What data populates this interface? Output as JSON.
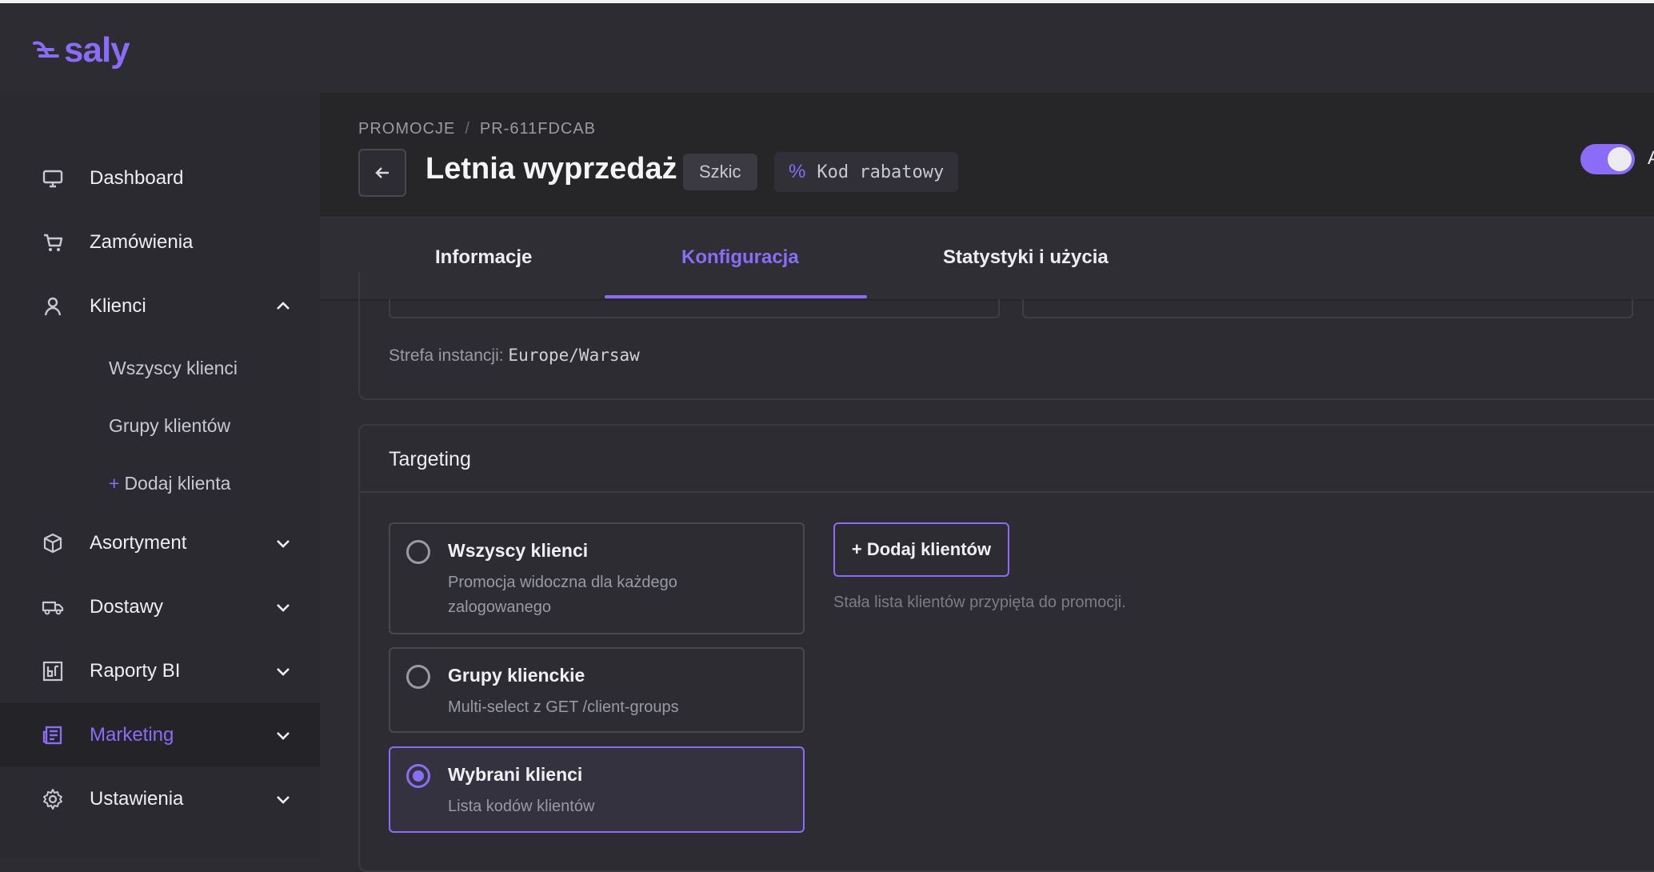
{
  "app": {
    "logo_text": "saly",
    "brand_color": "#8b6cf6"
  },
  "sidebar": {
    "items": [
      {
        "label": "Dashboard",
        "icon": "monitor-icon"
      },
      {
        "label": "Zamówienia",
        "icon": "cart-icon"
      },
      {
        "label": "Klienci",
        "icon": "user-icon",
        "expanded": true
      },
      {
        "label": "Asortyment",
        "icon": "box-icon"
      },
      {
        "label": "Dostawy",
        "icon": "truck-icon"
      },
      {
        "label": "Raporty BI",
        "icon": "report-icon"
      },
      {
        "label": "Marketing",
        "icon": "newspaper-icon",
        "active": true
      },
      {
        "label": "Ustawienia",
        "icon": "gear-icon"
      }
    ],
    "clients_sub": [
      {
        "label": "Wszyscy klienci"
      },
      {
        "label": "Grupy klientów"
      },
      {
        "label": "Dodaj klienta",
        "prefix": "+"
      }
    ]
  },
  "header": {
    "breadcrumb": [
      "PROMOCJE",
      "PR-611FDCAB"
    ],
    "breadcrumb_sep": "/",
    "title": "Letnia wyprzedaż",
    "status": "Szkic",
    "type_icon": "%",
    "type_label": "Kod rabatowy",
    "toggle_on": true,
    "toggle_label_partial": "A"
  },
  "tabs": [
    {
      "label": "Informacje"
    },
    {
      "label": "Konfiguracja",
      "active": true
    },
    {
      "label": "Statystyki i użycia"
    }
  ],
  "schedule": {
    "timezone_label": "Strefa instancji:",
    "timezone_value": "Europe/Warsaw"
  },
  "targeting": {
    "title": "Targeting",
    "options": [
      {
        "title": "Wszyscy klienci",
        "desc": "Promocja widoczna dla każdego zalogowanego",
        "selected": false
      },
      {
        "title": "Grupy klienckie",
        "desc": "Multi-select z GET /client-groups",
        "selected": false
      },
      {
        "title": "Wybrani klienci",
        "desc": "Lista kodów klientów",
        "selected": true
      }
    ],
    "add_button": "+ Dodaj klientów",
    "hint": "Stała lista klientów przypięta do promocji."
  }
}
